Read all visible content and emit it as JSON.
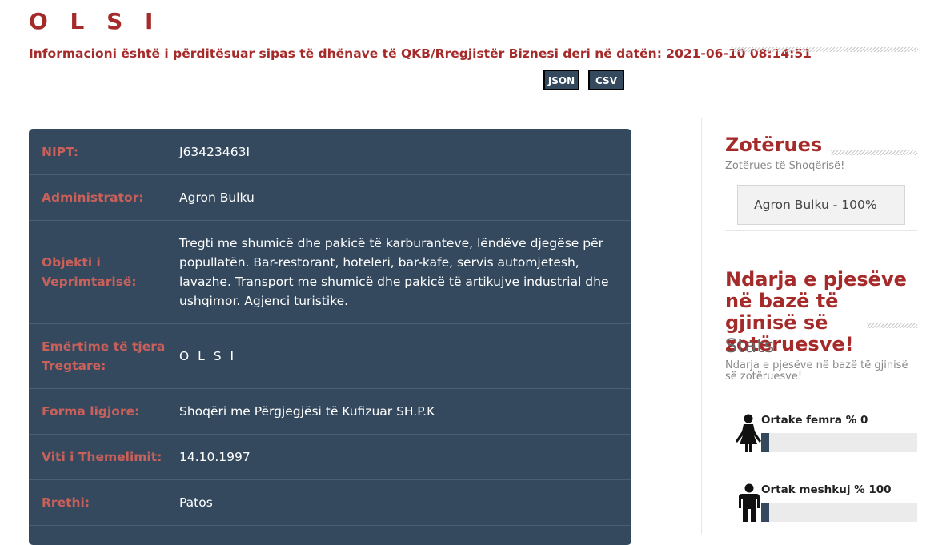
{
  "header": {
    "title": "O L S I",
    "updated_text": "Informacioni është i përditësuar sipas të dhënave të QKB/Rregjistër Biznesi deri në datën: 2021-06-10 08:14:51",
    "json_label": "JSON",
    "csv_label": "CSV"
  },
  "details": {
    "rows": [
      {
        "label": "NIPT:",
        "value": "J63423463I"
      },
      {
        "label": "Administrator:",
        "value": "Agron Bulku"
      },
      {
        "label": "Objekti i Veprimtarisë:",
        "value": "Tregti me shumicë dhe pakicë të karburanteve, lëndëve djegëse për popullatën. Bar-restorant, hoteleri, bar-kafe, servis automjetesh, lavazhe. Transport me shumicë dhe pakicë të artikujve industrial dhe ushqimor. Agjenci turistike."
      },
      {
        "label": "Emërtime të tjera Tregtare:",
        "value": "O L S I"
      },
      {
        "label": "Forma ligjore:",
        "value": "Shoqëri me Përgjegjësi të Kufizuar SH.P.K"
      },
      {
        "label": "Viti i Themelimit:",
        "value": "14.10.1997"
      },
      {
        "label": "Rrethi:",
        "value": "Patos"
      }
    ]
  },
  "sidebar": {
    "owners_title": "Zotërues",
    "owners_subtitle": "Zotërues të Shoqërisë!",
    "owner_entry": "Agron Bulku - 100%",
    "gender_title": "Ndarja e pjesëve në bazë të gjinisë së zotëruesve!",
    "stats_heading": "Stats",
    "stats_subtitle": "Ndarja e pjesëve në bazë të gjinisë së zotëruesve!",
    "female_label": "Ortake femra % 0",
    "female_percent": 0,
    "male_label": "Ortak meshkuj % 100",
    "male_percent": 100
  },
  "colors": {
    "accent": "#a52a2a",
    "panel": "#34495e",
    "label": "#c9605a"
  },
  "icons": [
    "female-icon",
    "male-icon"
  ]
}
